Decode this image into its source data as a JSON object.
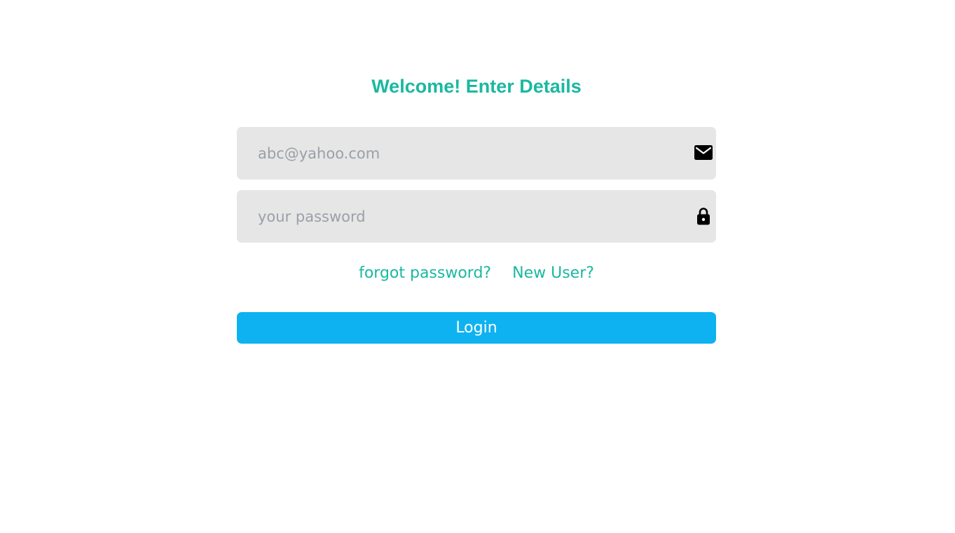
{
  "header": {
    "title": "Welcome! Enter Details"
  },
  "form": {
    "email": {
      "placeholder": "abc@yahoo.com",
      "icon": "envelope-icon"
    },
    "password": {
      "placeholder": "your password",
      "icon": "lock-icon"
    },
    "links": {
      "forgot_password": "forgot password?",
      "new_user": "New User?"
    },
    "login_label": "Login"
  },
  "colors": {
    "accent": "#1ab8a0",
    "button": "#0eb2f1",
    "field_bg": "#e6e6e6"
  }
}
